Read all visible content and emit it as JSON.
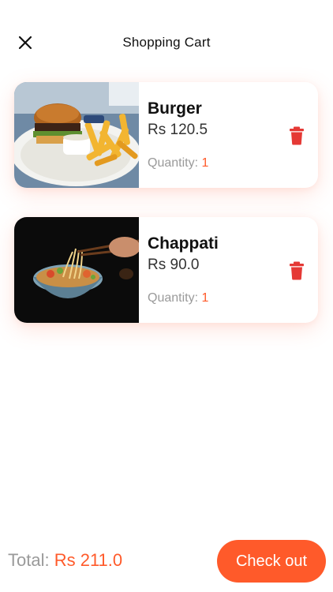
{
  "header": {
    "title": "Shopping Cart",
    "close_icon": "close-icon"
  },
  "cart": {
    "items": [
      {
        "name": "Burger",
        "price": "Rs 120.5",
        "quantity_label": "Quantity: ",
        "quantity": "1",
        "image": "burger-with-fries-photo",
        "delete_icon": "trash-icon"
      },
      {
        "name": "Chappati",
        "price": "Rs 90.0",
        "quantity_label": "Quantity: ",
        "quantity": "1",
        "image": "noodle-bowl-photo",
        "delete_icon": "trash-icon"
      }
    ]
  },
  "footer": {
    "total_label": "Total: ",
    "total_value": "Rs 211.0",
    "checkout_label": "Check out"
  },
  "colors": {
    "accent": "#ff5a2a",
    "delete": "#e53935",
    "muted": "#9a9a9a"
  }
}
